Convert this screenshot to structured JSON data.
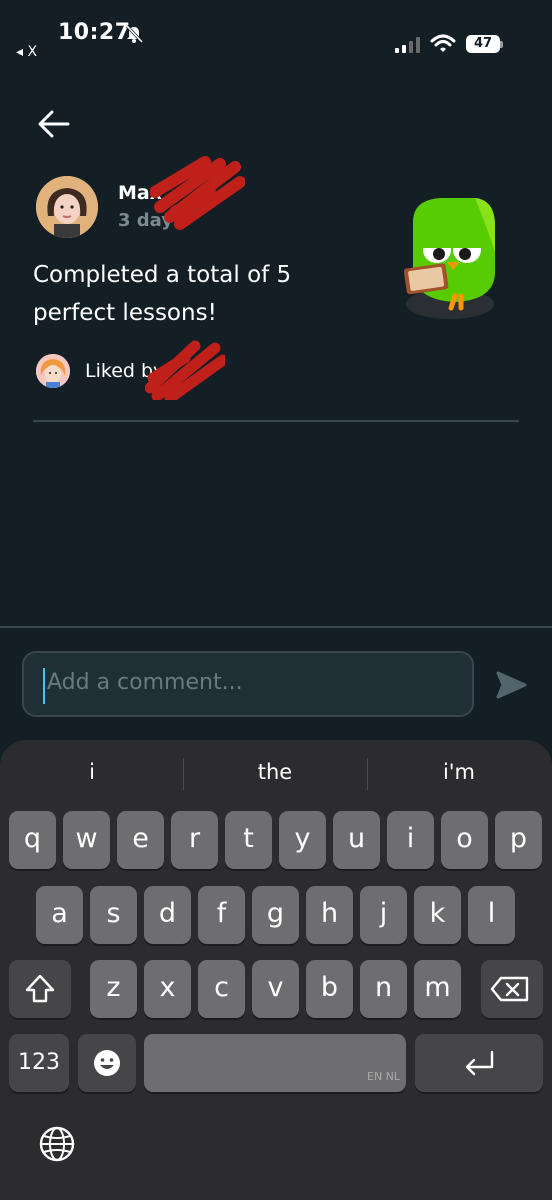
{
  "status_bar": {
    "time": "10:27",
    "back_label": "◂ X",
    "battery": "47"
  },
  "post": {
    "author": "Max",
    "time_ago": "3 days",
    "text": "Completed a total of 5 perfect lessons!",
    "liked_by_prefix": "Liked by"
  },
  "comment": {
    "placeholder": "Add a comment..."
  },
  "keyboard": {
    "suggestions": [
      "i",
      "the",
      "i'm"
    ],
    "row1": [
      "q",
      "w",
      "e",
      "r",
      "t",
      "y",
      "u",
      "i",
      "o",
      "p"
    ],
    "row2": [
      "a",
      "s",
      "d",
      "f",
      "g",
      "h",
      "j",
      "k",
      "l"
    ],
    "row3": [
      "z",
      "x",
      "c",
      "v",
      "b",
      "n",
      "m"
    ],
    "numbers_key": "123",
    "space_locale": "EN NL"
  },
  "colors": {
    "background": "#131f24",
    "divider": "#37464f",
    "accent_cursor": "#49c0f8",
    "redaction": "#c0201a",
    "mascot_green": "#58cc02"
  },
  "icons": {
    "back": "arrow-left-icon",
    "send": "send-icon",
    "shift": "shift-icon",
    "backspace": "backspace-icon",
    "emoji": "emoji-icon",
    "return": "return-icon",
    "globe": "globe-icon"
  }
}
